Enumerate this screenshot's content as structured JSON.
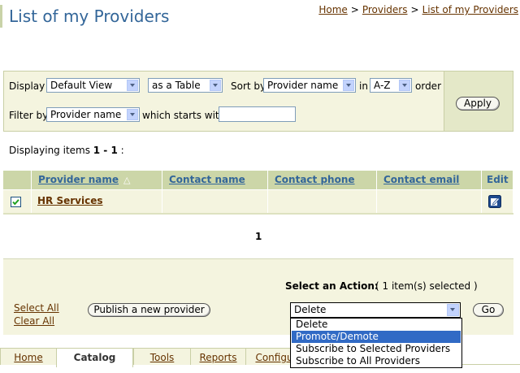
{
  "title": "List of my Providers",
  "breadcrumb": [
    "Home",
    "Providers",
    "List of my Providers"
  ],
  "breadcrumb_sep": ">",
  "filter": {
    "display_label": "Display",
    "view_value": "Default View",
    "format_value": "as a Table",
    "sort_label": "Sort by",
    "sort_value": "Provider name",
    "in_label": "in",
    "order_value": "A-Z",
    "order_label": "order",
    "filter_label": "Filter by",
    "filter_field_value": "Provider name",
    "starts_with_label": "which starts with",
    "filter_text_value": "",
    "apply_label": "Apply"
  },
  "displaying": {
    "prefix": "Displaying items ",
    "range": "1 - 1",
    "suffix": " :"
  },
  "table": {
    "columns": [
      "Provider name",
      "Contact name",
      "Contact phone",
      "Contact email",
      "Edit"
    ],
    "rows": [
      {
        "selected": true,
        "provider_name": "HR Services",
        "contact_name": "",
        "contact_phone": "",
        "contact_email": ""
      }
    ]
  },
  "pager": {
    "page": "1"
  },
  "actions": {
    "select_label": "Select an Action:",
    "selected_count": "( 1 item(s) selected )",
    "select_all": "Select All",
    "clear_all": "Clear All",
    "publish_label": "Publish a new provider",
    "current_action": "Delete",
    "go_label": "Go",
    "options": [
      "Delete",
      "Promote/Demote",
      "Subscribe to Selected Providers",
      "Subscribe to All Providers"
    ],
    "highlighted_index": 1
  },
  "tabs": [
    "Home",
    "Catalog",
    "Tools",
    "Reports",
    "Configu"
  ],
  "active_tab": "Catalog",
  "colors": {
    "title": "#336699",
    "link": "#663300",
    "panel": "#f4f4df",
    "header": "#ccd6a8",
    "highlight": "#316ac5"
  }
}
